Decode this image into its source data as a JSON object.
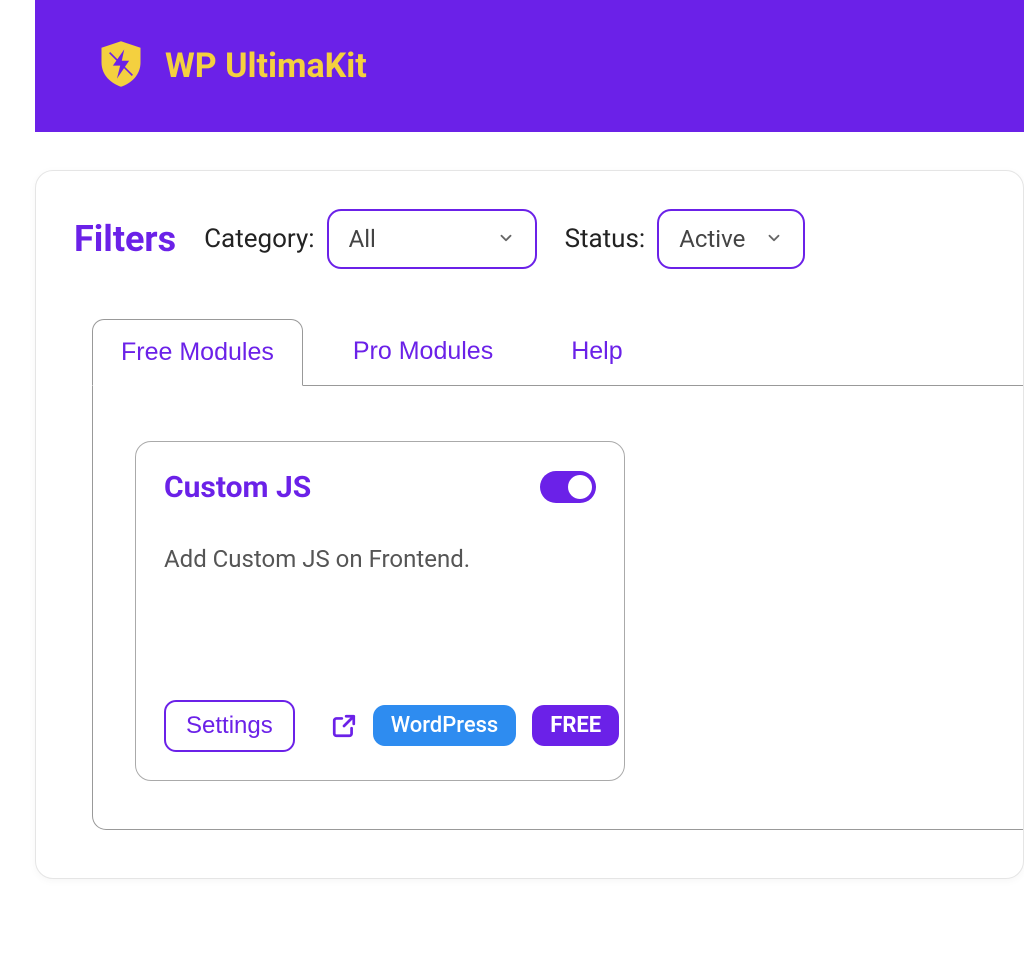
{
  "header": {
    "title": "WP UltimaKit"
  },
  "filters": {
    "label": "Filters",
    "category_label": "Category:",
    "category_value": "All",
    "status_label": "Status:",
    "status_value": "Active"
  },
  "tabs": {
    "free": "Free Modules",
    "pro": "Pro Modules",
    "help": "Help"
  },
  "modules": {
    "custom_js": {
      "title": "Custom JS",
      "description": "Add Custom JS on Frontend.",
      "enabled": true,
      "settings_label": "Settings",
      "badges": {
        "platform": "WordPress",
        "tier": "FREE"
      }
    }
  }
}
